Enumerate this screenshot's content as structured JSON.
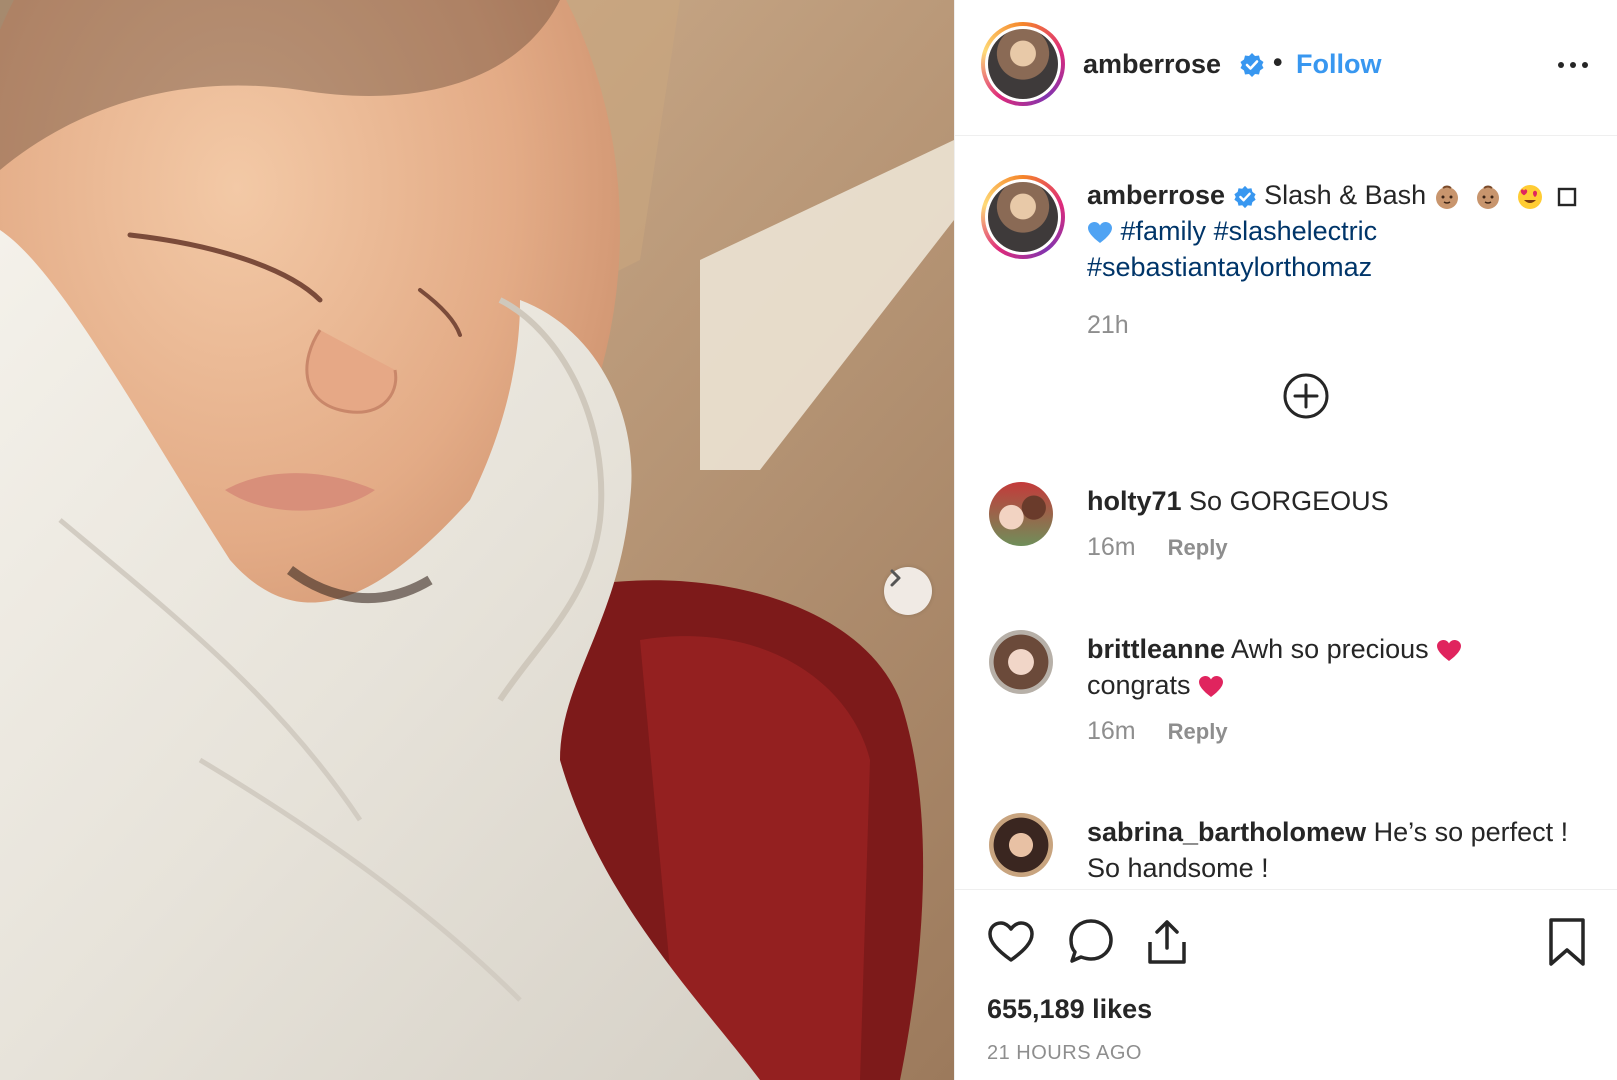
{
  "post": {
    "username": "amberrose",
    "follow_label": "Follow",
    "separator": "•"
  },
  "caption": {
    "username": "amberrose",
    "text": "Slash & Bash",
    "hashtags": [
      "#family",
      "#slashelectric",
      "#sebastiantaylorthomaz"
    ],
    "time": "21h",
    "emojis": [
      "baby-emoji",
      "baby-emoji",
      "heart-eyes-emoji",
      "box-glyph",
      "blue-heart-emoji"
    ]
  },
  "comments": [
    {
      "username": "holty71",
      "line1": "So GORGEOUS",
      "line2": "",
      "time": "16m",
      "reply_label": "Reply"
    },
    {
      "username": "brittleanne",
      "line1": "Awh so precious",
      "line2": "congrats",
      "time": "16m",
      "reply_label": "Reply"
    },
    {
      "username": "sabrina_bartholomew",
      "line1": "He’s so perfect !",
      "line2": "So handsome !",
      "time": "",
      "reply_label": ""
    }
  ],
  "footer": {
    "likes": "655,189 likes",
    "posted": "21 HOURS AGO"
  },
  "icons": {
    "like": "heart-icon",
    "comment": "comment-bubble-icon",
    "share": "share-icon",
    "save": "bookmark-icon",
    "more": "more-options-icon",
    "next": "chevron-right-icon",
    "load_more": "plus-circle-icon",
    "verified": "verified-badge-icon"
  },
  "colors": {
    "link": "#3897f0",
    "hashtag": "#003569",
    "muted": "#8e8e8e",
    "text": "#262626"
  }
}
